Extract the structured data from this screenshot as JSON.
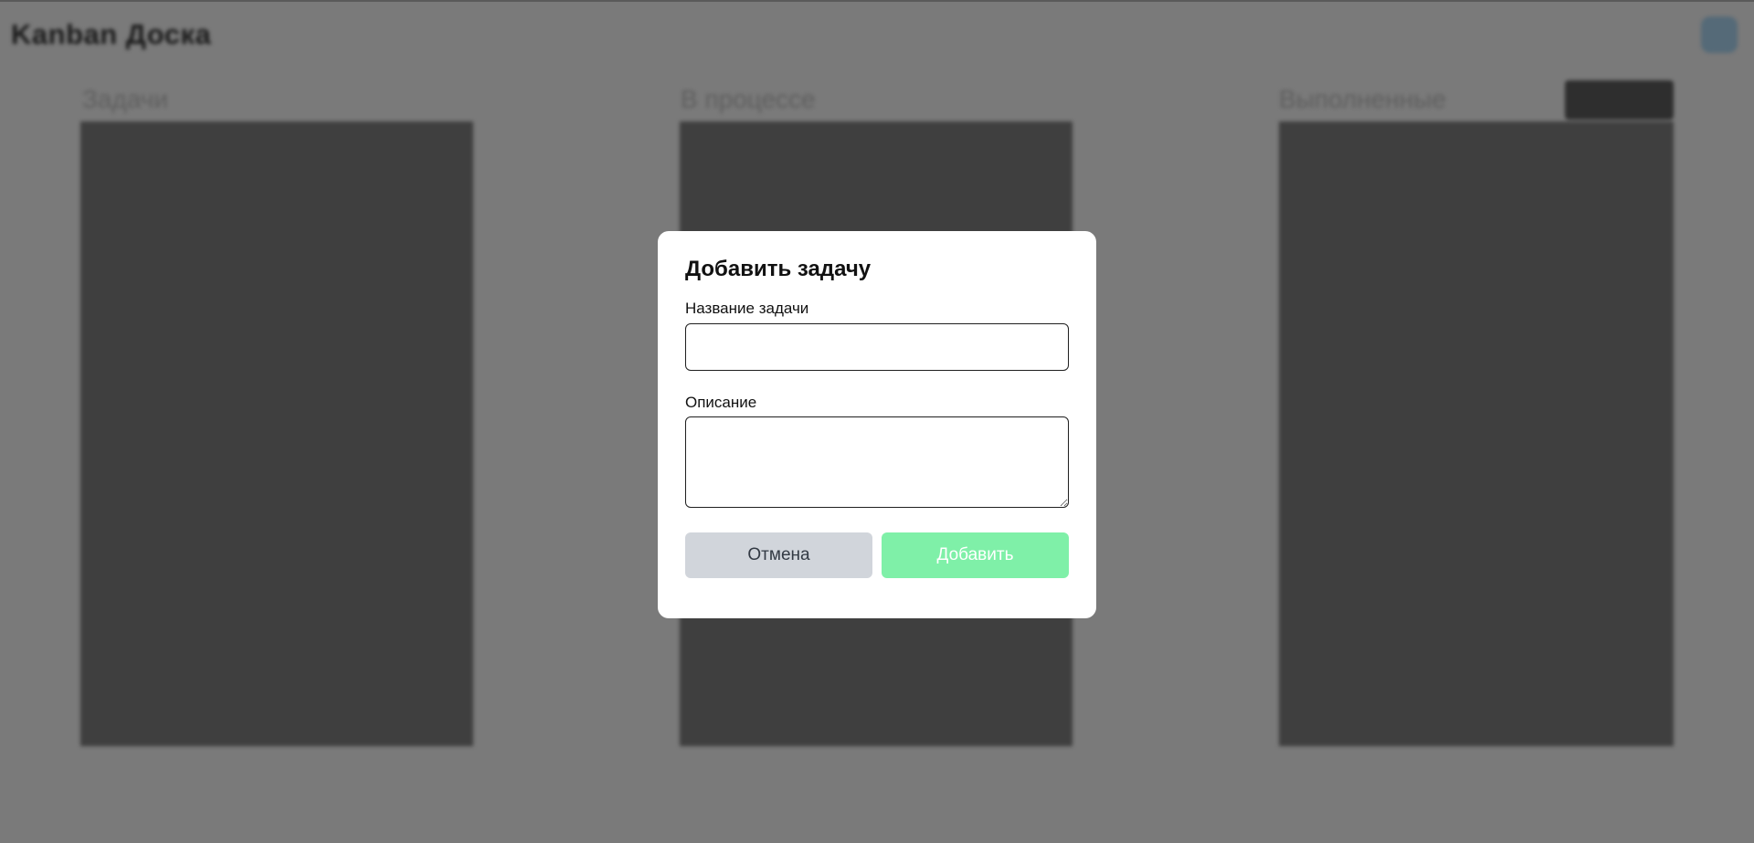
{
  "board": {
    "title": "Kanban Доска",
    "columns": [
      {
        "title": "Задачи"
      },
      {
        "title": "В процессе"
      },
      {
        "title": "Выполненные"
      }
    ]
  },
  "modal": {
    "title": "Добавить задачу",
    "task_name_label": "Название задачи",
    "task_name_value": "",
    "description_label": "Описание",
    "description_value": "",
    "cancel_label": "Отмена",
    "add_label": "Добавить"
  },
  "colors": {
    "overlay": "#7a7a7a",
    "column_bg": "#3f3f3f",
    "cancel_bg": "#d1d5db",
    "add_bg": "#7ff0a8"
  }
}
